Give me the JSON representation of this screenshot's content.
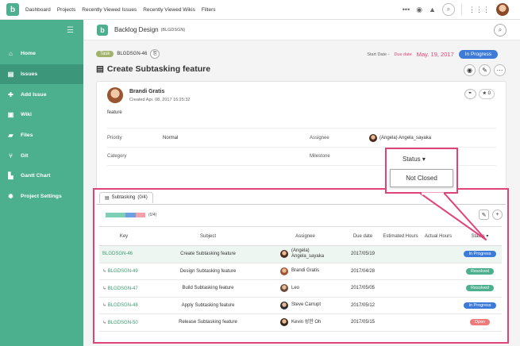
{
  "topbar": {
    "logo": "b",
    "nav": [
      "Dashboard",
      "Projects",
      "Recently Viewed Issues",
      "Recently Viewed Wikis",
      "Filters"
    ],
    "icons": [
      "more-icon",
      "watch-icon",
      "bell-icon",
      "search-icon",
      "apps-icon",
      "avatar"
    ]
  },
  "sidebar": {
    "items": [
      {
        "label": "Home",
        "icon": "home-icon"
      },
      {
        "label": "Issues",
        "icon": "issues-icon"
      },
      {
        "label": "Add Issue",
        "icon": "plus-icon"
      },
      {
        "label": "Wiki",
        "icon": "wiki-icon"
      },
      {
        "label": "Files",
        "icon": "folder-icon"
      },
      {
        "label": "Git",
        "icon": "git-icon"
      },
      {
        "label": "Gantt Chart",
        "icon": "gantt-icon"
      },
      {
        "label": "Project Settings",
        "icon": "gear-icon"
      }
    ],
    "active": "Issues"
  },
  "project": {
    "logo": "b",
    "name": "Backlog Design",
    "key": "(BLGDSGN)"
  },
  "issue": {
    "type": "Task",
    "key": "BLGDSGN-46",
    "start_label": "Start Date -",
    "due_label": "Due date",
    "due_value": "May. 19, 2017",
    "status": "In Progress",
    "title": "Create Subtasking feature",
    "author": "Brandi Gratis",
    "created": "Created Apr. 08, 2017 16:25:32",
    "description": "feature",
    "star_count": "0",
    "fields": {
      "priority_label": "Priority",
      "priority_value": "Normal",
      "assignee_label": "Assignee",
      "assignee_value": "(Angela) Angela_sayaka",
      "category_label": "Category",
      "milestone_label": "Milestone"
    }
  },
  "subtasking": {
    "tab_label": "Subtasking",
    "tab_count": "(0/4)",
    "progress_count": "(0/4)",
    "progress": [
      {
        "color": "#7dcfb6",
        "fraction": 0.5
      },
      {
        "color": "#6e9fe0",
        "fraction": 0.25
      },
      {
        "color": "#f4a0a8",
        "fraction": 0.25
      }
    ],
    "columns": [
      "Key",
      "Subject",
      "Assignee",
      "Due date",
      "Estimated Hours",
      "Actual Hours",
      "Status"
    ],
    "rows": [
      {
        "key": "BLGDSGN-46",
        "subject": "Create Subtasking feature",
        "assignee": "(Angela) Angela_sayaka",
        "due": "2017/05/19",
        "status": "In Progress",
        "status_color": "#3d7bd9",
        "child": false
      },
      {
        "key": "BLGDSGN-49",
        "subject": "Design Subtasking feature",
        "assignee": "Brandi Gratis",
        "due": "2017/04/28",
        "status": "Resolved",
        "status_color": "#4caf8d",
        "child": true
      },
      {
        "key": "BLGDSGN-47",
        "subject": "Build Subtasking feature",
        "assignee": "Leo",
        "due": "2017/05/05",
        "status": "Resolved",
        "status_color": "#4caf8d",
        "child": true
      },
      {
        "key": "BLGDSGN-48",
        "subject": "Apply Subtasking feature",
        "assignee": "Steve Carrupt",
        "due": "2017/05/12",
        "status": "In Progress",
        "status_color": "#3d7bd9",
        "child": true
      },
      {
        "key": "BLGDSGN-50",
        "subject": "Release Subtasking feature",
        "assignee": "Kevin 성한 Oh",
        "due": "2017/05/15",
        "status": "Open",
        "status_color": "#ee7a7a",
        "child": true
      }
    ]
  },
  "status_popup": {
    "header": "Status",
    "option": "Not Closed"
  },
  "colors": {
    "brand": "#4caf8d",
    "highlight": "#e0437a",
    "in_progress": "#3d7bd9"
  }
}
